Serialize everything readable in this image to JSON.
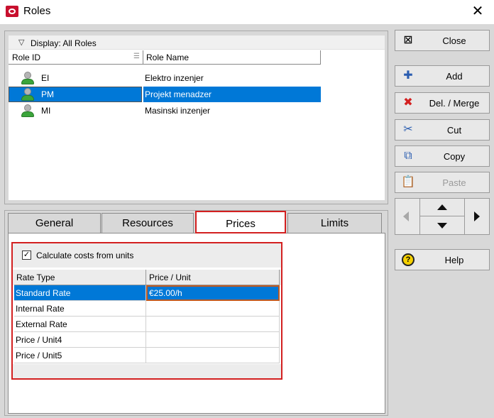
{
  "window": {
    "title": "Roles",
    "close_glyph": "✕"
  },
  "list": {
    "display_label": "Display: All Roles",
    "columns": {
      "role_id": "Role ID",
      "role_name": "Role Name"
    },
    "rows": [
      {
        "id": "EI",
        "name": "Elektro inzenjer",
        "selected": false
      },
      {
        "id": "PM",
        "name": "Projekt menadzer",
        "selected": true
      },
      {
        "id": "MI",
        "name": "Masinski inzenjer",
        "selected": false
      }
    ]
  },
  "tabs": [
    {
      "label": "General"
    },
    {
      "label": "Resources"
    },
    {
      "label": "Prices",
      "active": true
    },
    {
      "label": "Limits"
    }
  ],
  "prices": {
    "calc_label": "Calculate costs from units",
    "calc_checked": true,
    "headers": {
      "rate_type": "Rate Type",
      "price_unit": "Price / Unit"
    },
    "rates": [
      {
        "name": "Standard Rate",
        "value": "€25.00/h",
        "selected": true
      },
      {
        "name": "Internal Rate",
        "value": ""
      },
      {
        "name": "External Rate",
        "value": ""
      },
      {
        "name": "Price / Unit4",
        "value": ""
      },
      {
        "name": "Price / Unit5",
        "value": ""
      }
    ]
  },
  "buttons": {
    "close": "Close",
    "add": "Add",
    "delete_merge": "Del. / Merge",
    "cut": "Cut",
    "copy": "Copy",
    "paste": "Paste",
    "help": "Help"
  },
  "colors": {
    "selection": "#0078d7",
    "highlight_border": "#d32020"
  }
}
